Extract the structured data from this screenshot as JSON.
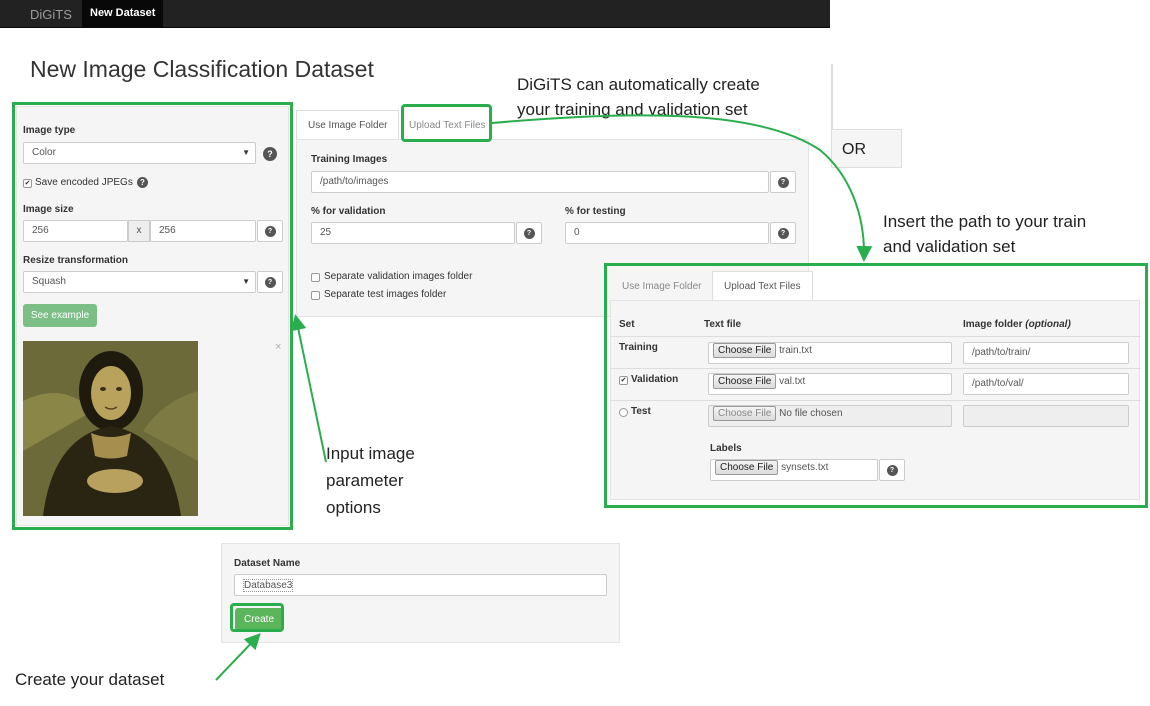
{
  "navbar": {
    "brand": "DiGiTS",
    "active_item": "New Dataset"
  },
  "page_title": "New Image Classification Dataset",
  "left_panel": {
    "image_type_label": "Image type",
    "image_type_value": "Color",
    "save_jpegs_label": "Save encoded JPEGs",
    "image_size_label": "Image size",
    "width": "256",
    "size_separator": "x",
    "height": "256",
    "resize_label": "Resize transformation",
    "resize_value": "Squash",
    "see_example": "See example",
    "close": "×"
  },
  "folder_form": {
    "tab_folder": "Use Image Folder",
    "tab_text": "Upload Text Files",
    "training_images_label": "Training Images",
    "training_images_value": "/path/to/images",
    "validation_label": "% for validation",
    "validation_value": "25",
    "testing_label": "% for testing",
    "testing_value": "0",
    "sep_val_folder": "Separate validation images folder",
    "sep_test_folder": "Separate test images folder"
  },
  "or_box": {
    "text": "OR"
  },
  "text_form": {
    "tab_folder": "Use Image Folder",
    "tab_text": "Upload Text Files",
    "col_set": "Set",
    "col_text_file": "Text file",
    "col_image_folder": "Image folder",
    "col_image_folder_optional": "(optional)",
    "choose_file": "Choose File",
    "training": {
      "label": "Training",
      "file": "train.txt",
      "folder": "/path/to/train/"
    },
    "validation": {
      "label": "Validation",
      "file": "val.txt",
      "folder": "/path/to/val/"
    },
    "test": {
      "label": "Test",
      "file": "No file chosen",
      "folder": ""
    },
    "labels_label": "Labels",
    "labels_file": "synsets.txt"
  },
  "dataset_name": {
    "label": "Dataset Name",
    "value": "Database3",
    "create": "Create"
  },
  "annotations": {
    "auto_create": [
      "DiGiTS can automatically create",
      "your training and validation set"
    ],
    "insert_path": [
      "Insert the path to your train",
      "and validation set"
    ],
    "input_params": [
      "Input image",
      "parameter",
      "options"
    ],
    "create_dataset": "Create your dataset"
  },
  "colors": {
    "highlight": "#2aae4d",
    "navbar": "#222222",
    "button": "#5bb55b"
  }
}
